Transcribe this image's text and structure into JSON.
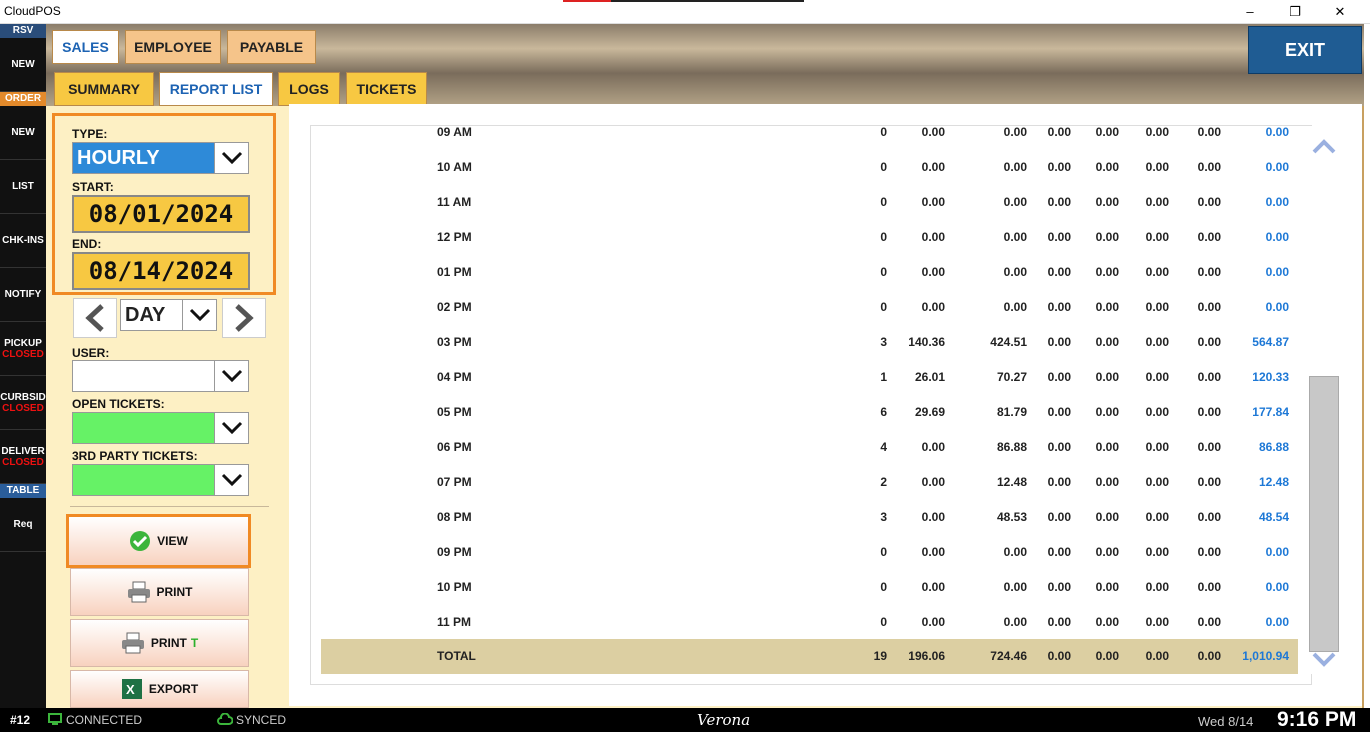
{
  "window": {
    "title": "CloudPOS",
    "minimize": "–",
    "maximize": "❐",
    "close": "✕"
  },
  "sidebar": {
    "head_rsv": "RSV",
    "new1": "NEW",
    "head_order": "ORDER",
    "new2": "NEW",
    "list": "LIST",
    "chkins": "CHK-INS",
    "notify": "NOTIFY",
    "pickup": "PICKUP",
    "pickup_status": "CLOSED",
    "curbside": "CURBSID",
    "curbside_status": "CLOSED",
    "delivery": "DELIVER",
    "delivery_status": "CLOSED",
    "head_table": "TABLE",
    "req": "Req"
  },
  "tabs": {
    "sales": "SALES",
    "employee": "EMPLOYEE",
    "payable": "PAYABLE"
  },
  "subtabs": {
    "summary": "SUMMARY",
    "report_list": "REPORT LIST",
    "logs": "LOGS",
    "tickets": "TICKETS"
  },
  "exit_label": "EXIT",
  "filters": {
    "type_label": "TYPE:",
    "type_value": "HOURLY",
    "start_label": "START:",
    "start_value": "08/01/2024",
    "end_label": "END:",
    "end_value": "08/14/2024",
    "period_value": "DAY",
    "user_label": "USER:",
    "user_value": "",
    "open_tickets_label": "OPEN TICKETS:",
    "third_party_label": "3RD PARTY TICKETS:"
  },
  "actions": {
    "view": "VIEW",
    "print": "PRINT",
    "print_t": "PRINT",
    "print_t_suffix": "T",
    "export": "EXPORT"
  },
  "rows": [
    {
      "time": "09 AM",
      "c1": "0",
      "c2": "0.00",
      "c3": "0.00",
      "c4": "0.00",
      "c5": "0.00",
      "c6": "0.00",
      "c7": "0.00",
      "total": "0.00"
    },
    {
      "time": "10 AM",
      "c1": "0",
      "c2": "0.00",
      "c3": "0.00",
      "c4": "0.00",
      "c5": "0.00",
      "c6": "0.00",
      "c7": "0.00",
      "total": "0.00"
    },
    {
      "time": "11 AM",
      "c1": "0",
      "c2": "0.00",
      "c3": "0.00",
      "c4": "0.00",
      "c5": "0.00",
      "c6": "0.00",
      "c7": "0.00",
      "total": "0.00"
    },
    {
      "time": "12 PM",
      "c1": "0",
      "c2": "0.00",
      "c3": "0.00",
      "c4": "0.00",
      "c5": "0.00",
      "c6": "0.00",
      "c7": "0.00",
      "total": "0.00"
    },
    {
      "time": "01 PM",
      "c1": "0",
      "c2": "0.00",
      "c3": "0.00",
      "c4": "0.00",
      "c5": "0.00",
      "c6": "0.00",
      "c7": "0.00",
      "total": "0.00"
    },
    {
      "time": "02 PM",
      "c1": "0",
      "c2": "0.00",
      "c3": "0.00",
      "c4": "0.00",
      "c5": "0.00",
      "c6": "0.00",
      "c7": "0.00",
      "total": "0.00"
    },
    {
      "time": "03 PM",
      "c1": "3",
      "c2": "140.36",
      "c3": "424.51",
      "c4": "0.00",
      "c5": "0.00",
      "c6": "0.00",
      "c7": "0.00",
      "total": "564.87"
    },
    {
      "time": "04 PM",
      "c1": "1",
      "c2": "26.01",
      "c3": "70.27",
      "c4": "0.00",
      "c5": "0.00",
      "c6": "0.00",
      "c7": "0.00",
      "total": "120.33"
    },
    {
      "time": "05 PM",
      "c1": "6",
      "c2": "29.69",
      "c3": "81.79",
      "c4": "0.00",
      "c5": "0.00",
      "c6": "0.00",
      "c7": "0.00",
      "total": "177.84"
    },
    {
      "time": "06 PM",
      "c1": "4",
      "c2": "0.00",
      "c3": "86.88",
      "c4": "0.00",
      "c5": "0.00",
      "c6": "0.00",
      "c7": "0.00",
      "total": "86.88"
    },
    {
      "time": "07 PM",
      "c1": "2",
      "c2": "0.00",
      "c3": "12.48",
      "c4": "0.00",
      "c5": "0.00",
      "c6": "0.00",
      "c7": "0.00",
      "total": "12.48"
    },
    {
      "time": "08 PM",
      "c1": "3",
      "c2": "0.00",
      "c3": "48.53",
      "c4": "0.00",
      "c5": "0.00",
      "c6": "0.00",
      "c7": "0.00",
      "total": "48.54"
    },
    {
      "time": "09 PM",
      "c1": "0",
      "c2": "0.00",
      "c3": "0.00",
      "c4": "0.00",
      "c5": "0.00",
      "c6": "0.00",
      "c7": "0.00",
      "total": "0.00"
    },
    {
      "time": "10 PM",
      "c1": "0",
      "c2": "0.00",
      "c3": "0.00",
      "c4": "0.00",
      "c5": "0.00",
      "c6": "0.00",
      "c7": "0.00",
      "total": "0.00"
    },
    {
      "time": "11 PM",
      "c1": "0",
      "c2": "0.00",
      "c3": "0.00",
      "c4": "0.00",
      "c5": "0.00",
      "c6": "0.00",
      "c7": "0.00",
      "total": "0.00"
    }
  ],
  "total_row": {
    "time": "TOTAL",
    "c1": "19",
    "c2": "196.06",
    "c3": "724.46",
    "c4": "0.00",
    "c5": "0.00",
    "c6": "0.00",
    "c7": "0.00",
    "total": "1,010.94"
  },
  "status": {
    "station": "#12",
    "connected": "CONNECTED",
    "synced": "SYNCED",
    "store": "Verona",
    "date": "Wed 8/14",
    "time": "9:16 PM"
  },
  "colors": {
    "accent_orange": "#f08a24",
    "link_blue": "#1d78d6",
    "exit_blue": "#1f5c93",
    "green_field": "#66f266"
  }
}
